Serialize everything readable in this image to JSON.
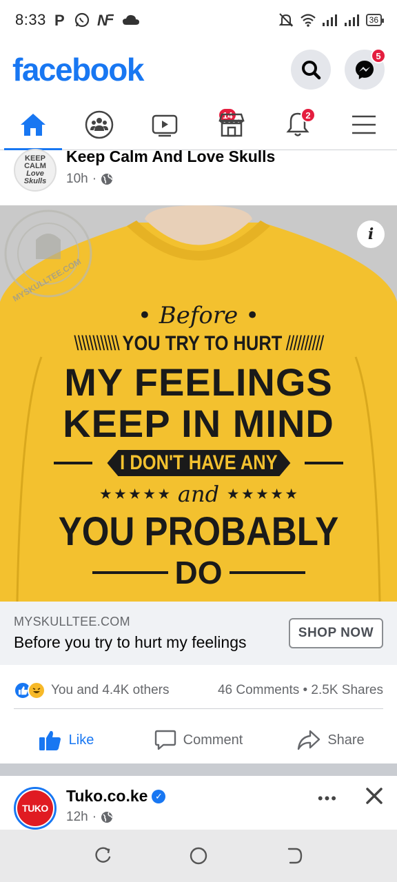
{
  "status_bar": {
    "time": "8:33",
    "battery": "36"
  },
  "app": {
    "logo": "facebook",
    "messenger_badge": "5"
  },
  "nav": {
    "watch_badge": "14",
    "notifications_badge": "2"
  },
  "post": {
    "avatar_lines": [
      "KEEP",
      "CALM",
      "Love",
      "Skulls"
    ],
    "page_name": "Keep Calm And Love Skulls",
    "time": "10h",
    "image": {
      "watermark": "MYSKULLTEE.COM",
      "line1": "• Before •",
      "line2": "YOU TRY TO HURT",
      "line3": "MY FEELINGS",
      "line4": "KEEP IN MIND",
      "line5": "I DON'T HAVE ANY",
      "line6": "and",
      "line7": "YOU PROBABLY",
      "line8": "DO"
    },
    "ad": {
      "domain": "MYSKULLTEE.COM",
      "headline": "Before you try to hurt my feelings",
      "cta": "SHOP NOW"
    },
    "reactions_text": "You and 4.4K others",
    "comments_shares": "46 Comments • 2.5K Shares",
    "actions": {
      "like": "Like",
      "comment": "Comment",
      "share": "Share"
    }
  },
  "next_post": {
    "avatar_text": "TUKO",
    "page_name": "Tuko.co.ke",
    "time": "12h"
  },
  "colors": {
    "brand": "#1877f2",
    "badge": "#e41e3f",
    "shirt": "#f2c02b"
  }
}
